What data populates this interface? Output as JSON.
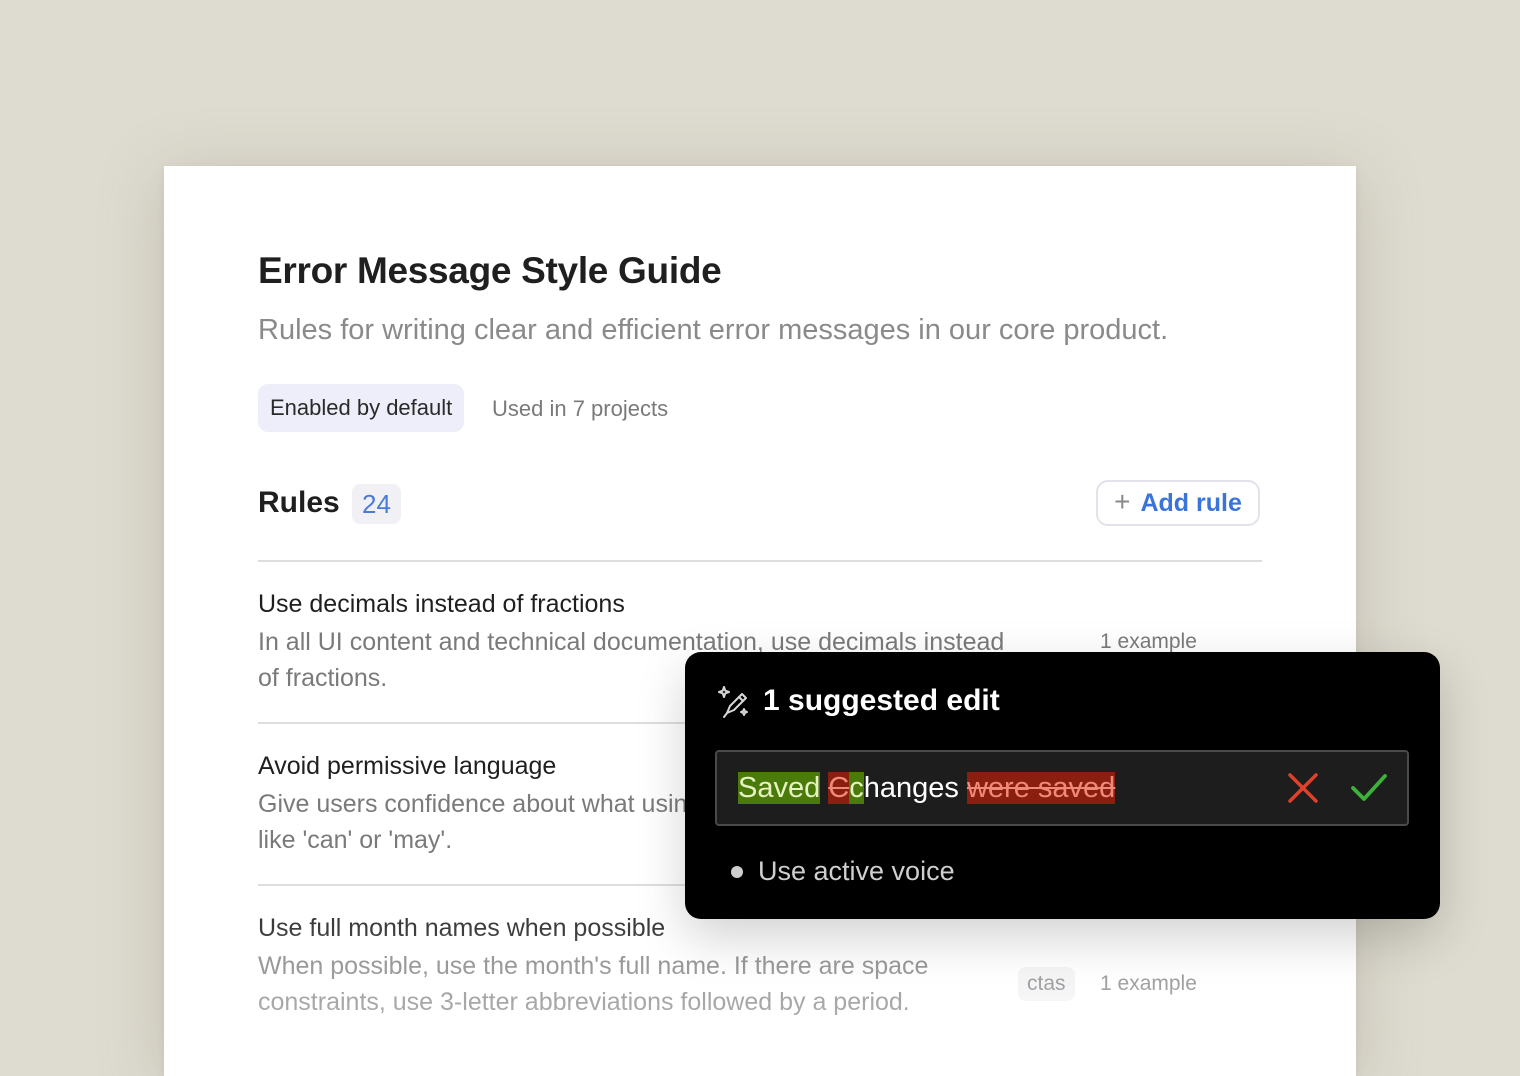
{
  "guide": {
    "title": "Error Message Style Guide",
    "subtitle": "Rules for writing clear and efficient error messages in our core product.",
    "badge": "Enabled by default",
    "used_in": "Used in 7 projects"
  },
  "rules_section": {
    "heading": "Rules",
    "count": "24",
    "add_button": {
      "icon": "plus-icon",
      "label": "Add rule"
    }
  },
  "rules": [
    {
      "title": "Use decimals instead of fractions",
      "description": "In all UI content and technical documentation, use decimals instead of fractions.",
      "examples": "1 example"
    },
    {
      "title": "Avoid permissive language",
      "description": "Give users confidence about what using words like 'can' or 'may'."
    },
    {
      "title": "Use full month names when possible",
      "description": "When possible, use the month's full name. If there are space constraints, use 3-letter abbreviations followed by a period.",
      "tag": "ctas",
      "examples": "1 example"
    }
  ],
  "suggestion_popup": {
    "icon": "magic-pen-icon",
    "title": "1 suggested edit",
    "edit": {
      "inserted_word": "Saved",
      "deleted_letter": "C",
      "inserted_letter": "c",
      "unchanged": "hanges",
      "deleted_phrase": "were saved"
    },
    "reject_icon": "close-icon",
    "accept_icon": "check-icon",
    "rule": "Use active voice"
  },
  "colors": {
    "background": "#dedbd0",
    "accent_blue": "#3a74d9",
    "insert_green": "#4a7a0a",
    "delete_red": "#8a1f10",
    "reject_red": "#e0412b",
    "accept_green": "#3cb23a"
  }
}
